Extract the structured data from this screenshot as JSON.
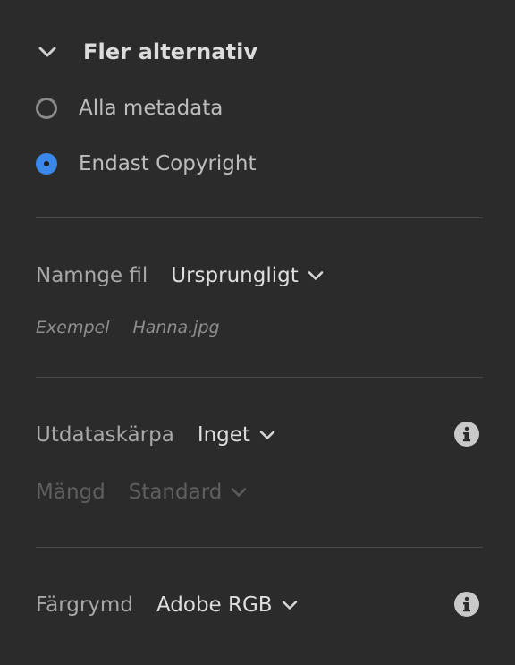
{
  "options_section": {
    "title": "Fler alternativ",
    "expanded": true,
    "metadata_options": [
      {
        "label": "Alla metadata",
        "selected": false
      },
      {
        "label": "Endast Copyright",
        "selected": true
      }
    ]
  },
  "naming": {
    "label": "Namnge fil",
    "value": "Ursprungligt",
    "example_label": "Exempel",
    "example_value": "Hanna.jpg"
  },
  "sharpening": {
    "label": "Utdataskärpa",
    "value": "Inget",
    "amount_label": "Mängd",
    "amount_value": "Standard",
    "amount_enabled": false
  },
  "color_space": {
    "label": "Färgrymd",
    "value": "Adobe RGB"
  },
  "colors": {
    "background": "#2b2b2b",
    "accent": "#3b88ea",
    "divider": "#474747"
  },
  "icons": [
    "chevron-down-icon",
    "info-icon"
  ]
}
